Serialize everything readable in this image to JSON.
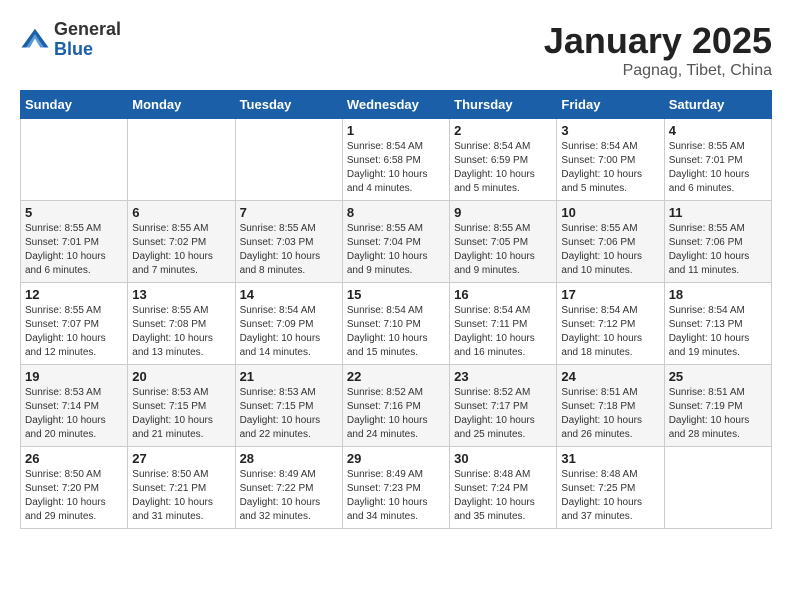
{
  "logo": {
    "general": "General",
    "blue": "Blue"
  },
  "title": "January 2025",
  "location": "Pagnag, Tibet, China",
  "weekdays": [
    "Sunday",
    "Monday",
    "Tuesday",
    "Wednesday",
    "Thursday",
    "Friday",
    "Saturday"
  ],
  "weeks": [
    [
      {
        "day": "",
        "info": ""
      },
      {
        "day": "",
        "info": ""
      },
      {
        "day": "",
        "info": ""
      },
      {
        "day": "1",
        "info": "Sunrise: 8:54 AM\nSunset: 6:58 PM\nDaylight: 10 hours\nand 4 minutes."
      },
      {
        "day": "2",
        "info": "Sunrise: 8:54 AM\nSunset: 6:59 PM\nDaylight: 10 hours\nand 5 minutes."
      },
      {
        "day": "3",
        "info": "Sunrise: 8:54 AM\nSunset: 7:00 PM\nDaylight: 10 hours\nand 5 minutes."
      },
      {
        "day": "4",
        "info": "Sunrise: 8:55 AM\nSunset: 7:01 PM\nDaylight: 10 hours\nand 6 minutes."
      }
    ],
    [
      {
        "day": "5",
        "info": "Sunrise: 8:55 AM\nSunset: 7:01 PM\nDaylight: 10 hours\nand 6 minutes."
      },
      {
        "day": "6",
        "info": "Sunrise: 8:55 AM\nSunset: 7:02 PM\nDaylight: 10 hours\nand 7 minutes."
      },
      {
        "day": "7",
        "info": "Sunrise: 8:55 AM\nSunset: 7:03 PM\nDaylight: 10 hours\nand 8 minutes."
      },
      {
        "day": "8",
        "info": "Sunrise: 8:55 AM\nSunset: 7:04 PM\nDaylight: 10 hours\nand 9 minutes."
      },
      {
        "day": "9",
        "info": "Sunrise: 8:55 AM\nSunset: 7:05 PM\nDaylight: 10 hours\nand 9 minutes."
      },
      {
        "day": "10",
        "info": "Sunrise: 8:55 AM\nSunset: 7:06 PM\nDaylight: 10 hours\nand 10 minutes."
      },
      {
        "day": "11",
        "info": "Sunrise: 8:55 AM\nSunset: 7:06 PM\nDaylight: 10 hours\nand 11 minutes."
      }
    ],
    [
      {
        "day": "12",
        "info": "Sunrise: 8:55 AM\nSunset: 7:07 PM\nDaylight: 10 hours\nand 12 minutes."
      },
      {
        "day": "13",
        "info": "Sunrise: 8:55 AM\nSunset: 7:08 PM\nDaylight: 10 hours\nand 13 minutes."
      },
      {
        "day": "14",
        "info": "Sunrise: 8:54 AM\nSunset: 7:09 PM\nDaylight: 10 hours\nand 14 minutes."
      },
      {
        "day": "15",
        "info": "Sunrise: 8:54 AM\nSunset: 7:10 PM\nDaylight: 10 hours\nand 15 minutes."
      },
      {
        "day": "16",
        "info": "Sunrise: 8:54 AM\nSunset: 7:11 PM\nDaylight: 10 hours\nand 16 minutes."
      },
      {
        "day": "17",
        "info": "Sunrise: 8:54 AM\nSunset: 7:12 PM\nDaylight: 10 hours\nand 18 minutes."
      },
      {
        "day": "18",
        "info": "Sunrise: 8:54 AM\nSunset: 7:13 PM\nDaylight: 10 hours\nand 19 minutes."
      }
    ],
    [
      {
        "day": "19",
        "info": "Sunrise: 8:53 AM\nSunset: 7:14 PM\nDaylight: 10 hours\nand 20 minutes."
      },
      {
        "day": "20",
        "info": "Sunrise: 8:53 AM\nSunset: 7:15 PM\nDaylight: 10 hours\nand 21 minutes."
      },
      {
        "day": "21",
        "info": "Sunrise: 8:53 AM\nSunset: 7:15 PM\nDaylight: 10 hours\nand 22 minutes."
      },
      {
        "day": "22",
        "info": "Sunrise: 8:52 AM\nSunset: 7:16 PM\nDaylight: 10 hours\nand 24 minutes."
      },
      {
        "day": "23",
        "info": "Sunrise: 8:52 AM\nSunset: 7:17 PM\nDaylight: 10 hours\nand 25 minutes."
      },
      {
        "day": "24",
        "info": "Sunrise: 8:51 AM\nSunset: 7:18 PM\nDaylight: 10 hours\nand 26 minutes."
      },
      {
        "day": "25",
        "info": "Sunrise: 8:51 AM\nSunset: 7:19 PM\nDaylight: 10 hours\nand 28 minutes."
      }
    ],
    [
      {
        "day": "26",
        "info": "Sunrise: 8:50 AM\nSunset: 7:20 PM\nDaylight: 10 hours\nand 29 minutes."
      },
      {
        "day": "27",
        "info": "Sunrise: 8:50 AM\nSunset: 7:21 PM\nDaylight: 10 hours\nand 31 minutes."
      },
      {
        "day": "28",
        "info": "Sunrise: 8:49 AM\nSunset: 7:22 PM\nDaylight: 10 hours\nand 32 minutes."
      },
      {
        "day": "29",
        "info": "Sunrise: 8:49 AM\nSunset: 7:23 PM\nDaylight: 10 hours\nand 34 minutes."
      },
      {
        "day": "30",
        "info": "Sunrise: 8:48 AM\nSunset: 7:24 PM\nDaylight: 10 hours\nand 35 minutes."
      },
      {
        "day": "31",
        "info": "Sunrise: 8:48 AM\nSunset: 7:25 PM\nDaylight: 10 hours\nand 37 minutes."
      },
      {
        "day": "",
        "info": ""
      }
    ]
  ]
}
